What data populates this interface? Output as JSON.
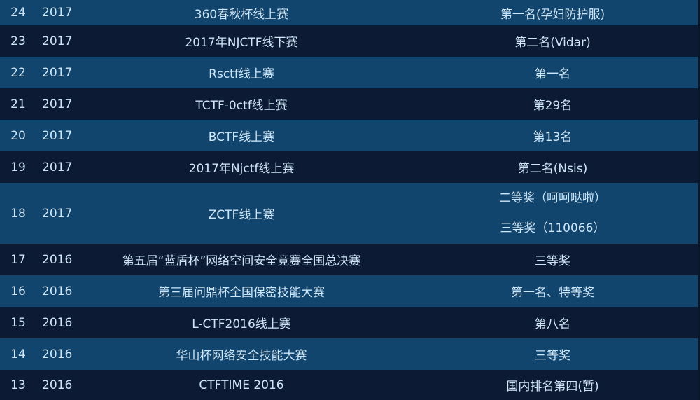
{
  "rows": [
    {
      "id": "24",
      "year": "2017",
      "name": "360春秋杯线上赛",
      "rank": [
        "第一名(孕妇防护服)"
      ]
    },
    {
      "id": "23",
      "year": "2017",
      "name": "2017年NJCTF线下赛",
      "rank": [
        "第二名(Vidar)"
      ]
    },
    {
      "id": "22",
      "year": "2017",
      "name": "Rsctf线上赛",
      "rank": [
        "第一名"
      ]
    },
    {
      "id": "21",
      "year": "2017",
      "name": "TCTF-0ctf线上赛",
      "rank": [
        "第29名"
      ]
    },
    {
      "id": "20",
      "year": "2017",
      "name": "BCTF线上赛",
      "rank": [
        "第13名"
      ]
    },
    {
      "id": "19",
      "year": "2017",
      "name": "2017年Njctf线上赛",
      "rank": [
        "第二名(Nsis)"
      ]
    },
    {
      "id": "18",
      "year": "2017",
      "name": "ZCTF线上赛",
      "rank": [
        "二等奖（呵呵哒啦）",
        "三等奖（110066）"
      ]
    },
    {
      "id": "17",
      "year": "2016",
      "name": "第五届“蓝盾杯”网络空间安全竞赛全国总决赛",
      "rank": [
        "三等奖"
      ]
    },
    {
      "id": "16",
      "year": "2016",
      "name": "第三届问鼎杯全国保密技能大赛",
      "rank": [
        "第一名、特等奖"
      ]
    },
    {
      "id": "15",
      "year": "2016",
      "name": "L-CTF2016线上赛",
      "rank": [
        "第八名"
      ]
    },
    {
      "id": "14",
      "year": "2016",
      "name": "华山杯网络安全技能大赛",
      "rank": [
        "三等奖"
      ]
    },
    {
      "id": "13",
      "year": "2016",
      "name": "CTFTIME 2016",
      "rank": [
        "国内排名第四(暂)"
      ]
    }
  ],
  "colors": {
    "row_light": "#11456e",
    "row_dark": "#0c1a34",
    "text": "#cfe6f7"
  }
}
